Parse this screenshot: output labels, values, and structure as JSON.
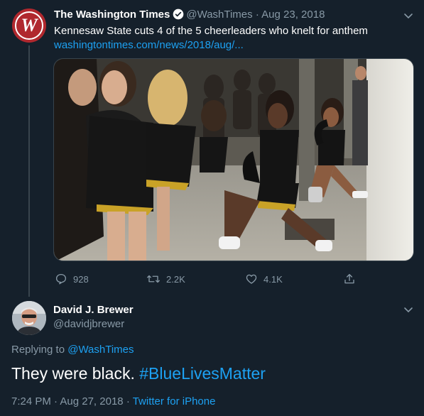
{
  "tweet1": {
    "avatar_letter": "W",
    "display_name": "The Washington Times",
    "handle": "@WashTimes",
    "separator": "·",
    "date": "Aug 23, 2018",
    "text": "Kennesaw State cuts 4 of the 5 cheerleaders who knelt for anthem",
    "link": "washingtontimes.com/news/2018/aug/...",
    "actions": {
      "replies": "928",
      "retweets": "2.2K",
      "likes": "4.1K"
    }
  },
  "tweet2": {
    "display_name": "David J. Brewer",
    "handle": "@davidjbrewer",
    "replying_prefix": "Replying to ",
    "replying_handle": "@WashTimes",
    "text_plain": "They were black. ",
    "text_hashtag": "#BlueLivesMatter",
    "time": "7:24 PM",
    "date": "Aug 27, 2018",
    "separator": "·",
    "source": "Twitter for iPhone"
  },
  "colors": {
    "background": "#15202b",
    "muted": "#8899a6",
    "link": "#1da1f2",
    "brand_red": "#b0282e"
  }
}
